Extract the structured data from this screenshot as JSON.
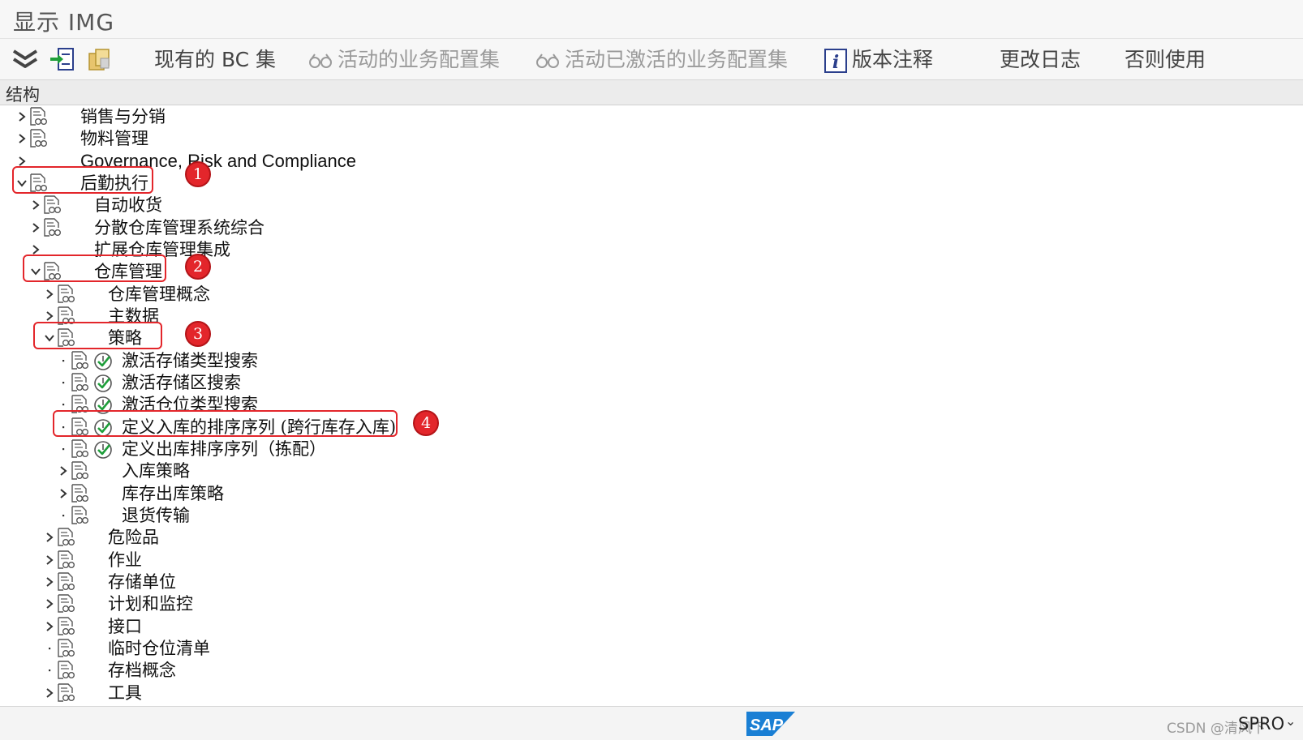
{
  "window": {
    "title": "显示 IMG"
  },
  "toolbar": {
    "buttons": [
      {
        "label": "现有的 BC 集",
        "enabled": true
      },
      {
        "label": "活动的业务配置集",
        "enabled": false
      },
      {
        "label": "活动已激活的业务配置集",
        "enabled": false
      },
      {
        "label": "版本注释",
        "enabled": true
      },
      {
        "label": "更改日志",
        "enabled": true
      },
      {
        "label": "否则使用",
        "enabled": true
      }
    ]
  },
  "structure_header": "结构",
  "tree": [
    {
      "label": "销售与分销",
      "level": 0,
      "toggle": "collapsed",
      "doc_icon": true,
      "activity_icon": false
    },
    {
      "label": "物料管理",
      "level": 0,
      "toggle": "collapsed",
      "doc_icon": true,
      "activity_icon": false
    },
    {
      "label": "Governance, Risk and Compliance",
      "level": 0,
      "toggle": "collapsed",
      "doc_icon": false,
      "activity_icon": false
    },
    {
      "label": "后勤执行",
      "level": 0,
      "toggle": "expanded",
      "doc_icon": true,
      "activity_icon": false,
      "marker": "1"
    },
    {
      "label": "自动收货",
      "level": 1,
      "toggle": "collapsed",
      "doc_icon": true,
      "activity_icon": false
    },
    {
      "label": "分散仓库管理系统综合",
      "level": 1,
      "toggle": "collapsed",
      "doc_icon": true,
      "activity_icon": false
    },
    {
      "label": "扩展仓库管理集成",
      "level": 1,
      "toggle": "collapsed",
      "doc_icon": false,
      "activity_icon": false
    },
    {
      "label": "仓库管理",
      "level": 1,
      "toggle": "expanded",
      "doc_icon": true,
      "activity_icon": false,
      "marker": "2"
    },
    {
      "label": "仓库管理概念",
      "level": 2,
      "toggle": "collapsed",
      "doc_icon": true,
      "activity_icon": false
    },
    {
      "label": "主数据",
      "level": 2,
      "toggle": "collapsed",
      "doc_icon": true,
      "activity_icon": false
    },
    {
      "label": "策略",
      "level": 2,
      "toggle": "expanded",
      "doc_icon": true,
      "activity_icon": false,
      "marker": "3"
    },
    {
      "label": "激活存储类型搜索",
      "level": 3,
      "toggle": "leaf",
      "doc_icon": true,
      "activity_icon": true
    },
    {
      "label": "激活存储区搜索",
      "level": 3,
      "toggle": "leaf",
      "doc_icon": true,
      "activity_icon": true
    },
    {
      "label": "激活仓位类型搜索",
      "level": 3,
      "toggle": "leaf",
      "doc_icon": true,
      "activity_icon": true
    },
    {
      "label": "定义入库的排序序列 (跨行库存入库)",
      "level": 3,
      "toggle": "leaf",
      "doc_icon": true,
      "activity_icon": true,
      "marker": "4"
    },
    {
      "label": "定义出库排序序列（拣配）",
      "level": 3,
      "toggle": "leaf",
      "doc_icon": true,
      "activity_icon": true
    },
    {
      "label": "入库策略",
      "level": 3,
      "toggle": "collapsed",
      "doc_icon": true,
      "activity_icon": false
    },
    {
      "label": "库存出库策略",
      "level": 3,
      "toggle": "collapsed",
      "doc_icon": true,
      "activity_icon": false
    },
    {
      "label": "退货传输",
      "level": 3,
      "toggle": "leaf",
      "doc_icon": true,
      "activity_icon": false
    },
    {
      "label": "危险品",
      "level": 2,
      "toggle": "collapsed",
      "doc_icon": true,
      "activity_icon": false
    },
    {
      "label": "作业",
      "level": 2,
      "toggle": "collapsed",
      "doc_icon": true,
      "activity_icon": false
    },
    {
      "label": "存储单位",
      "level": 2,
      "toggle": "collapsed",
      "doc_icon": true,
      "activity_icon": false
    },
    {
      "label": "计划和监控",
      "level": 2,
      "toggle": "collapsed",
      "doc_icon": true,
      "activity_icon": false
    },
    {
      "label": "接口",
      "level": 2,
      "toggle": "collapsed",
      "doc_icon": true,
      "activity_icon": false
    },
    {
      "label": "临时仓位清单",
      "level": 2,
      "toggle": "leaf",
      "doc_icon": true,
      "activity_icon": false
    },
    {
      "label": "存档概念",
      "level": 2,
      "toggle": "leaf",
      "doc_icon": true,
      "activity_icon": false
    },
    {
      "label": "工具",
      "level": 2,
      "toggle": "collapsed",
      "doc_icon": true,
      "activity_icon": false
    }
  ],
  "status_bar": {
    "logo": "SAP",
    "watermark": "CSDN @清风下",
    "transaction": "SPRO"
  }
}
